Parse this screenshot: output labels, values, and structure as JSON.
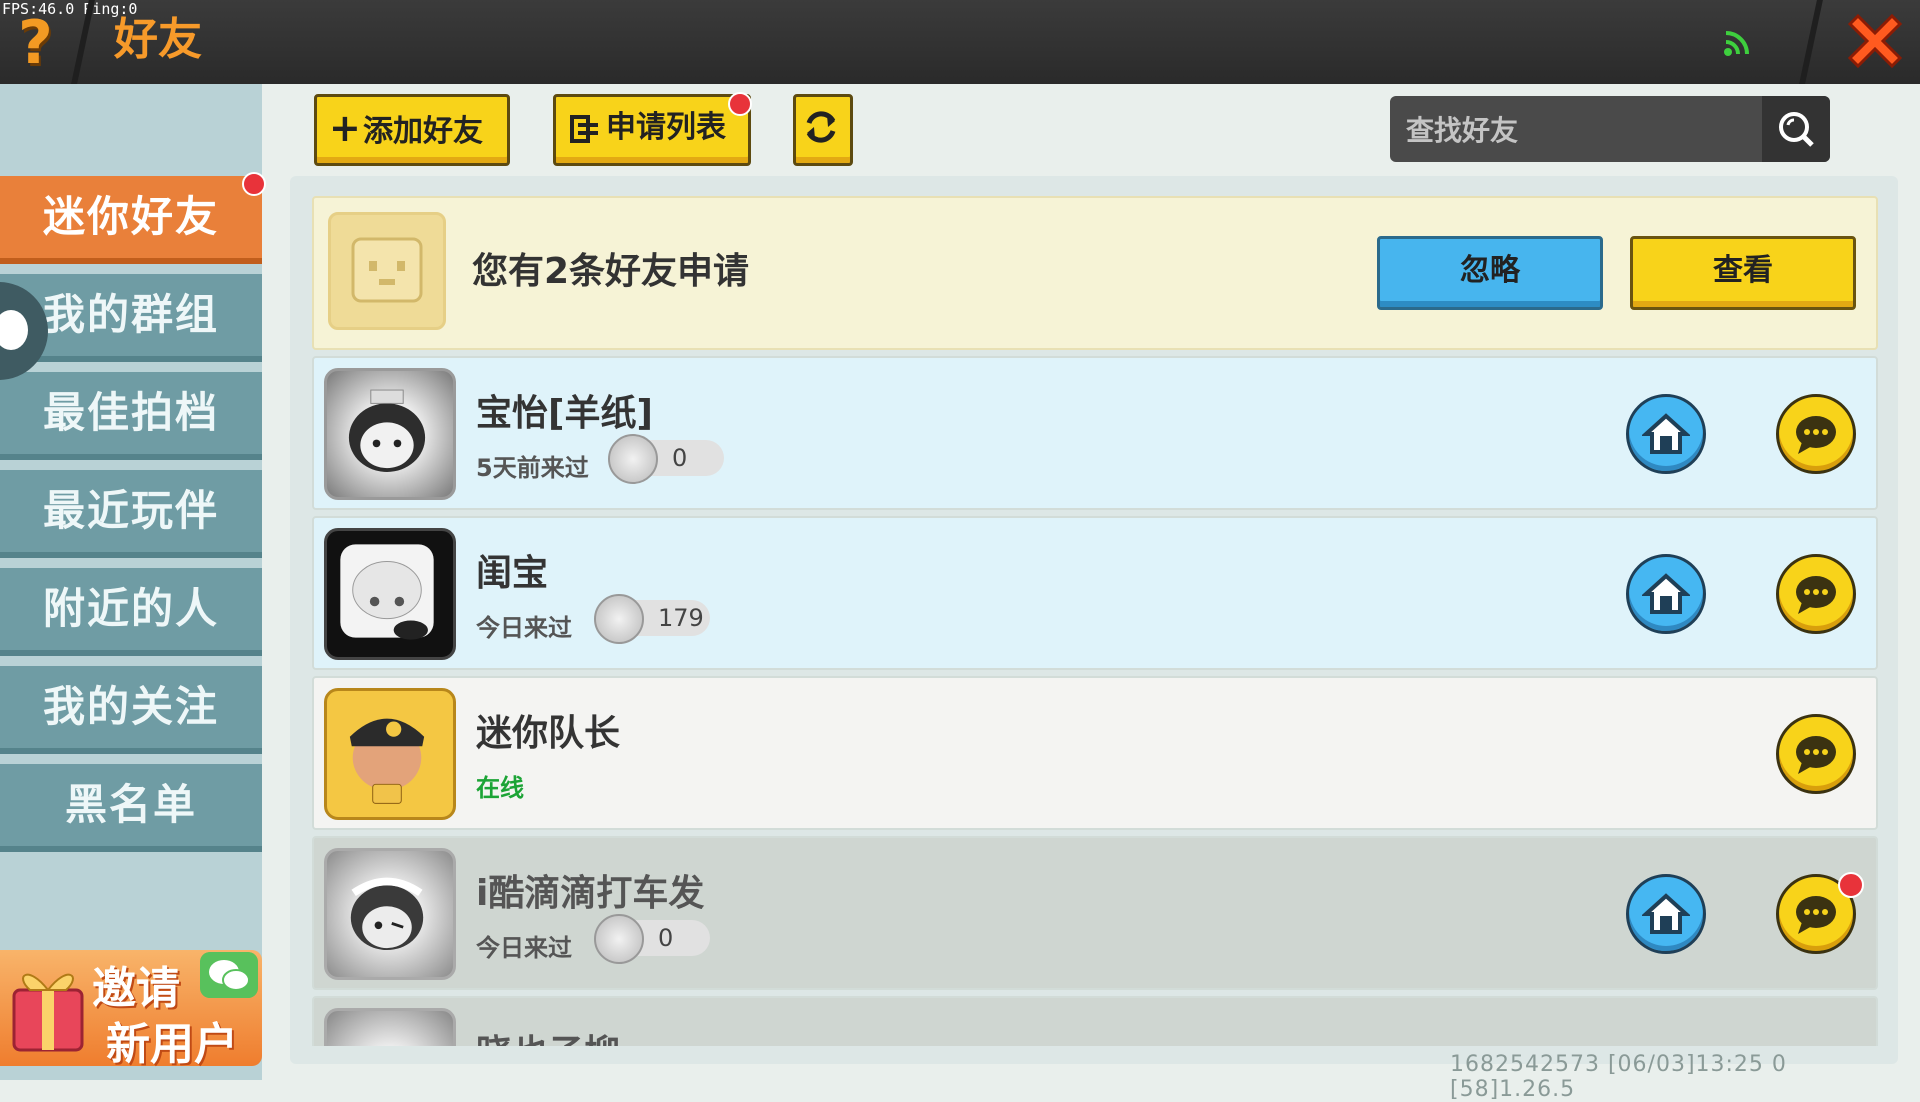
{
  "status": {
    "fps": "FPS:46.0  Ping:0"
  },
  "header": {
    "title": "好友"
  },
  "nav": {
    "items": [
      {
        "label": "迷你好友"
      },
      {
        "label": "我的群组"
      },
      {
        "label": "最佳拍档"
      },
      {
        "label": "最近玩伴"
      },
      {
        "label": "附近的人"
      },
      {
        "label": "我的关注"
      },
      {
        "label": "黑名单"
      }
    ],
    "invite_line1": "邀请",
    "invite_line2": "新用户"
  },
  "toolbar": {
    "add_label": "添加好友",
    "apply_label": "申请列表",
    "search_placeholder": "查找好友"
  },
  "request": {
    "text": "您有2条好友申请",
    "ignore_label": "忽略",
    "view_label": "查看"
  },
  "friends": [
    {
      "name": "宝怡[羊纸]",
      "status": "5天前来过",
      "count": "0"
    },
    {
      "name": "闺宝",
      "status": "今日来过",
      "count": "179"
    },
    {
      "name": "迷你队长",
      "status": "在线"
    },
    {
      "name": "i酷滴滴打车发",
      "status": "今日来过",
      "count": "0"
    },
    {
      "name": "晓也子柳"
    }
  ],
  "footer": {
    "text": "1682542573   [06/03]13:25 0  [58]1.26.5"
  },
  "colors": {
    "accent": "#e9803a",
    "yellow": "#f8d31a",
    "blue": "#47b5ee",
    "online": "#1ca436"
  }
}
